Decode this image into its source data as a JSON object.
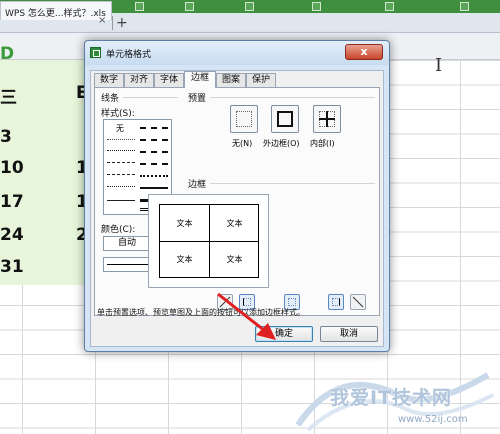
{
  "window": {
    "tab_title": "WPS 怎么更...样式？.xls",
    "tab_close": "×",
    "new_tab": "+"
  },
  "sheet": {
    "column_letter": "D",
    "cells_a": [
      "三",
      "3",
      "10",
      "17",
      "24",
      "31"
    ],
    "cells_b": [
      "E",
      "",
      "1",
      "1",
      "2",
      ""
    ]
  },
  "dialog": {
    "title": "单元格格式",
    "close_label": "x",
    "tabs": [
      {
        "label": "数字",
        "active": false
      },
      {
        "label": "对齐",
        "active": false
      },
      {
        "label": "字体",
        "active": false
      },
      {
        "label": "边框",
        "active": true
      },
      {
        "label": "图案",
        "active": false
      },
      {
        "label": "保护",
        "active": false
      }
    ],
    "line_group": "线条",
    "style_label": "样式(S):",
    "style_none": "无",
    "color_label": "颜色(C):",
    "color_value": "自动",
    "preset_group": "预置",
    "presets": [
      {
        "label": "无(N)"
      },
      {
        "label": "外边框(O)"
      },
      {
        "label": "内部(I)"
      }
    ],
    "border_group": "边框",
    "preview_cells": [
      "文本",
      "文本",
      "文本",
      "文本"
    ],
    "hint": "单击预置选项、预览草图及上面的按钮可以添加边框样式。",
    "ok_label": "确定",
    "cancel_label": "取消"
  },
  "watermark": {
    "text": "我爱IT技术网",
    "url": "www.52ij.com"
  }
}
